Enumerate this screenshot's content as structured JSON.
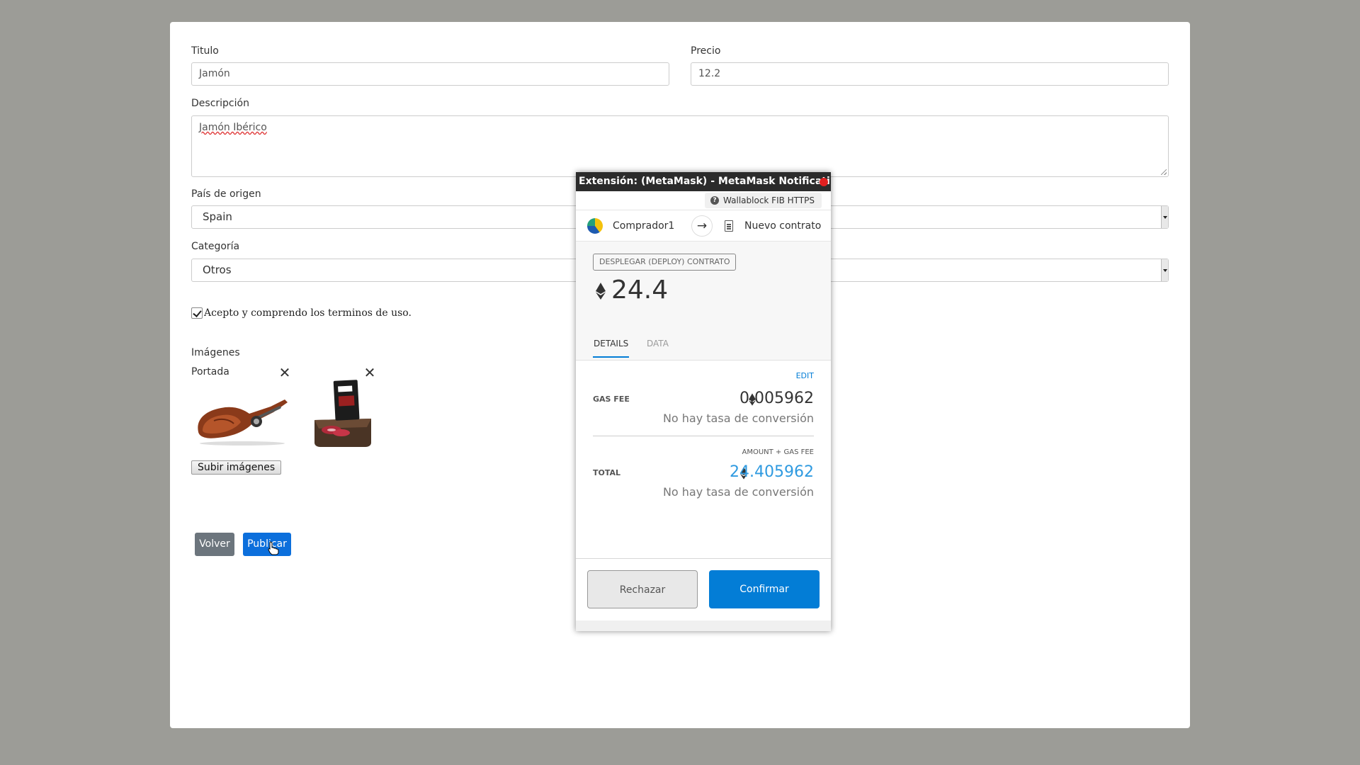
{
  "form": {
    "title_label": "Titulo",
    "title_value": "Jamón",
    "price_label": "Precio",
    "price_value": "12.2",
    "description_label": "Descripción",
    "description_value": "Jamón Ibérico",
    "country_label": "País de origen",
    "country_value": "Spain",
    "category_label": "Categoría",
    "category_value": "Otros",
    "terms_label": "Acepto y comprendo los terminos de uso.",
    "terms_checked": true,
    "images_label": "Imágenes",
    "cover_label": "Portada",
    "upload_button": "Subir imágenes",
    "back_button": "Volver",
    "publish_button": "Publicar"
  },
  "metamask": {
    "window_title": "Extensión: (MetaMask) - MetaMask Notificati...",
    "network": "Wallablock FIB HTTPS",
    "from_account": "Comprador1",
    "to": "Nuevo contrato",
    "action": "DESPLEGAR (DEPLOY) CONTRATO",
    "amount": "24.4",
    "tabs": [
      "DETAILS",
      "DATA"
    ],
    "edit_label": "EDIT",
    "gas_fee_label": "GAS FEE",
    "gas_fee_value": "0.005962",
    "no_conversion": "No hay tasa de conversión",
    "amount_gas_label": "AMOUNT + GAS FEE",
    "total_label": "TOTAL",
    "total_value": "24.405962",
    "reject_button": "Rechazar",
    "confirm_button": "Confirmar"
  },
  "colors": {
    "accent": "#037dd6",
    "publish": "#0c6fdc",
    "back": "#6c757d",
    "total": "#2f9ae0"
  }
}
